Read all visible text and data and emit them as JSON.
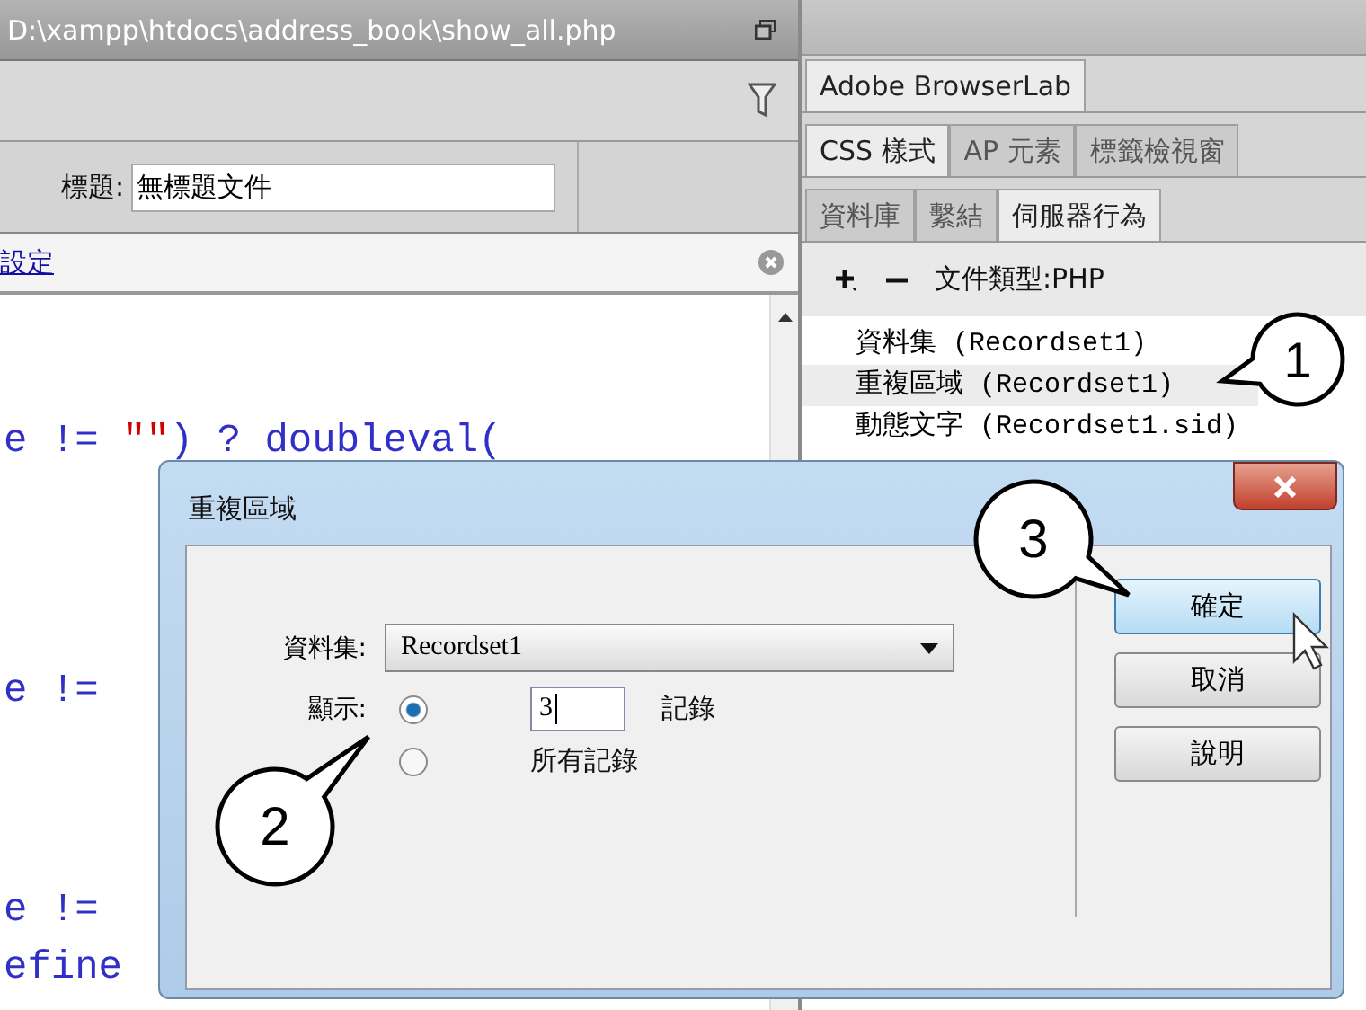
{
  "editor": {
    "path": "D:\\xampp\\htdocs\\address_book\\show_all.php",
    "title_label": "標題:",
    "title_value": "無標題文件",
    "info_link": "設定",
    "code_lines": [
      {
        "tokens": [
          {
            "kind": "plain",
            "text": "e != "
          },
          {
            "kind": "string",
            "text": "\"\""
          },
          {
            "kind": "plain",
            "text": ") ? doubleval("
          }
        ]
      },
      {
        "tokens": [
          {
            "kind": "plain",
            "text": "e !="
          }
        ]
      },
      {
        "tokens": [
          {
            "kind": "plain",
            "text": "e !="
          }
        ]
      },
      {
        "tokens": [
          {
            "kind": "plain",
            "text": "efine"
          }
        ]
      }
    ]
  },
  "panel": {
    "tab_rows": [
      [
        {
          "label": "Adobe BrowserLab",
          "selected": true
        }
      ],
      [
        {
          "label": "CSS 樣式",
          "selected": true
        },
        {
          "label": "AP 元素",
          "selected": false
        },
        {
          "label": "標籤檢視窗",
          "selected": false
        }
      ],
      [
        {
          "label": "資料庫",
          "selected": false
        },
        {
          "label": "繫結",
          "selected": false
        },
        {
          "label": "伺服器行為",
          "selected": true
        }
      ]
    ],
    "doc_type": "文件類型:PHP",
    "behaviors": [
      {
        "label": "資料集 (Recordset1)",
        "selected": false
      },
      {
        "label": "重複區域 (Recordset1)",
        "selected": true
      },
      {
        "label": "動態文字 (Recordset1.sid)",
        "selected": false
      }
    ]
  },
  "dialog": {
    "title": "重複區域",
    "recordset_label": "資料集:",
    "recordset_value": "Recordset1",
    "show_label": "顯示:",
    "options": [
      {
        "kind": "count",
        "selected": true,
        "value": "3",
        "suffix": "記錄"
      },
      {
        "kind": "all",
        "selected": false,
        "label": "所有記錄"
      }
    ],
    "buttons": [
      {
        "label": "確定",
        "focused": true
      },
      {
        "label": "取消",
        "focused": false
      },
      {
        "label": "說明",
        "focused": false
      }
    ]
  },
  "callouts": [
    {
      "number": "1"
    },
    {
      "number": "2"
    },
    {
      "number": "3"
    }
  ]
}
